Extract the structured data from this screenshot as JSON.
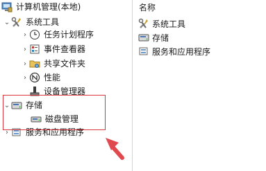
{
  "tree": {
    "root_label": "计算机管理(本地)",
    "system_tools_label": "系统工具",
    "task_scheduler_label": "任务计划程序",
    "event_viewer_label": "事件查看器",
    "shared_folders_label": "共享文件夹",
    "performance_label": "性能",
    "device_manager_label": "设备管理器",
    "storage_label": "存储",
    "disk_management_label": "磁盘管理",
    "services_apps_label": "服务和应用程序"
  },
  "list": {
    "header_name": "名称",
    "items": [
      "系统工具",
      "存储",
      "服务和应用程序"
    ]
  },
  "colors": {
    "highlight": "#d9363e",
    "arrow": "#e04a4f"
  }
}
